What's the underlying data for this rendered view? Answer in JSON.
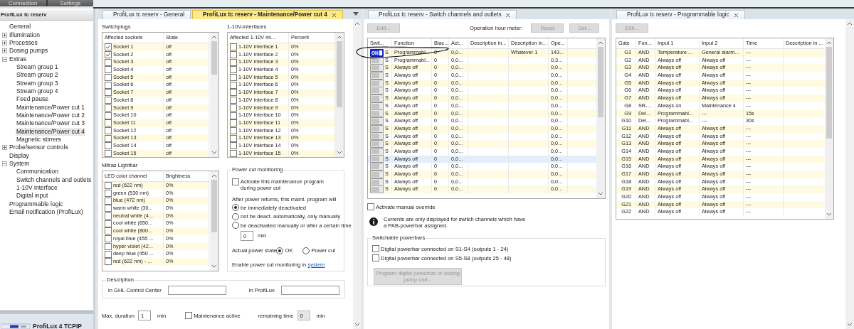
{
  "top_tabs": [
    "Connection",
    "Settings"
  ],
  "sidebar": {
    "title": "ProfiLux tc reserv",
    "tree": [
      {
        "label": "General",
        "kind": "leaf",
        "selected": false
      },
      {
        "label": "Illumination",
        "kind": "folder",
        "expanded": false,
        "selected": false
      },
      {
        "label": "Processes",
        "kind": "folder",
        "expanded": false,
        "selected": false
      },
      {
        "label": "Dosing pumps",
        "kind": "folder",
        "expanded": false,
        "selected": false
      },
      {
        "label": "Extras",
        "kind": "folder",
        "expanded": true,
        "selected": false,
        "children": [
          {
            "label": "Stream group 1",
            "selected": false
          },
          {
            "label": "Stream group 2",
            "selected": false
          },
          {
            "label": "Stream group 3",
            "selected": false
          },
          {
            "label": "Stream group 4",
            "selected": false
          },
          {
            "label": "Feed pause",
            "selected": false
          },
          {
            "label": "Maintenance/Power cut 1",
            "selected": false
          },
          {
            "label": "Maintenance/Power cut 2",
            "selected": false
          },
          {
            "label": "Maintenance/Power cut 3",
            "selected": false
          },
          {
            "label": "Maintenance/Power cut 4",
            "selected": true
          },
          {
            "label": "Magnetic stirrers",
            "selected": false
          }
        ]
      },
      {
        "label": "Probe/sensor controls",
        "kind": "folder",
        "expanded": false,
        "selected": false
      },
      {
        "label": "Display",
        "kind": "leaf",
        "selected": false
      },
      {
        "label": "System",
        "kind": "folder",
        "expanded": true,
        "selected": false,
        "children": [
          {
            "label": "Communication",
            "selected": false
          },
          {
            "label": "Switch channels and outlets",
            "selected": false
          },
          {
            "label": "1-10V interface",
            "selected": false
          },
          {
            "label": "Digital input",
            "selected": false
          }
        ]
      },
      {
        "label": "Programmable logic",
        "kind": "leaf",
        "selected": false
      },
      {
        "label": "Email notification (ProfiLux)",
        "kind": "leaf",
        "selected": false
      }
    ],
    "bottom_tab": "ProfiLux 4 TCPIP"
  },
  "maintenance_pane": {
    "tabs": [
      {
        "label": "ProfiLux tc reserv - General",
        "selected": false,
        "closable": false
      },
      {
        "label": "ProfiLux tc reserv - Maintenance/Power cut 4",
        "selected": true,
        "closable": true
      }
    ],
    "switchplugs": {
      "title": "Switchplugs",
      "kind": "list",
      "columns": [
        "Affected sockets",
        "State"
      ],
      "rows": [
        {
          "checked": true,
          "cells": [
            "Socket 1",
            "off"
          ]
        },
        {
          "checked": true,
          "cells": [
            "Socket 2",
            "off"
          ]
        },
        {
          "checked": false,
          "cells": [
            "Socket 3",
            "off"
          ]
        },
        {
          "checked": false,
          "cells": [
            "Socket 4",
            "off"
          ]
        },
        {
          "checked": false,
          "cells": [
            "Socket 5",
            "off"
          ]
        },
        {
          "checked": false,
          "cells": [
            "Socket 6",
            "off"
          ]
        },
        {
          "checked": false,
          "cells": [
            "Socket 7",
            "off"
          ]
        },
        {
          "checked": false,
          "cells": [
            "Socket 8",
            "off"
          ]
        },
        {
          "checked": false,
          "cells": [
            "Socket 9",
            "off"
          ]
        },
        {
          "checked": false,
          "cells": [
            "Socket 10",
            "off"
          ]
        },
        {
          "checked": false,
          "cells": [
            "Socket 11",
            "off"
          ]
        },
        {
          "checked": false,
          "cells": [
            "Socket 12",
            "off"
          ]
        },
        {
          "checked": false,
          "cells": [
            "Socket 13",
            "off"
          ]
        },
        {
          "checked": false,
          "cells": [
            "Socket 14",
            "off"
          ]
        },
        {
          "checked": false,
          "cells": [
            "Socket 15",
            "off"
          ]
        }
      ]
    },
    "interfaces": {
      "title": "1-10V-interfaces",
      "kind": "list",
      "columns": [
        "Affected 1-10V int...",
        "Percent"
      ],
      "rows": [
        {
          "checked": false,
          "cells": [
            "1-10V interface 1",
            "0%"
          ]
        },
        {
          "checked": false,
          "cells": [
            "1-10V interface 2",
            "0%"
          ]
        },
        {
          "checked": false,
          "cells": [
            "1-10V interface 3",
            "0%"
          ]
        },
        {
          "checked": false,
          "cells": [
            "1-10V interface 4",
            "0%"
          ]
        },
        {
          "checked": false,
          "cells": [
            "1-10V interface 5",
            "0%"
          ]
        },
        {
          "checked": false,
          "cells": [
            "1-10V interface 6",
            "0%"
          ]
        },
        {
          "checked": false,
          "cells": [
            "1-10V interface 7",
            "0%"
          ]
        },
        {
          "checked": false,
          "cells": [
            "1-10V interface 8",
            "0%"
          ]
        },
        {
          "checked": false,
          "cells": [
            "1-10V interface 9",
            "0%"
          ]
        },
        {
          "checked": false,
          "cells": [
            "1-10V interface 10",
            "0%"
          ]
        },
        {
          "checked": false,
          "cells": [
            "1-10V interface 11",
            "0%"
          ]
        },
        {
          "checked": false,
          "cells": [
            "1-10V interface 12",
            "0%"
          ]
        },
        {
          "checked": false,
          "cells": [
            "1-10V interface 13",
            "0%"
          ]
        },
        {
          "checked": false,
          "cells": [
            "1-10V interface 14",
            "0%"
          ]
        },
        {
          "checked": false,
          "cells": [
            "1-10V interface 15",
            "0%"
          ]
        }
      ]
    },
    "lightbar": {
      "title": "Mitras Lightbar",
      "kind": "list",
      "columns": [
        "LED color channel",
        "Brightness"
      ],
      "rows": [
        {
          "checked": false,
          "cells": [
            "red (622 nm)",
            "0%"
          ]
        },
        {
          "checked": false,
          "cells": [
            "green (530 nm)",
            "0%"
          ]
        },
        {
          "checked": false,
          "cells": [
            "blue (472 nm)",
            "0%"
          ]
        },
        {
          "checked": false,
          "cells": [
            "warm white (30...",
            "0%"
          ]
        },
        {
          "checked": false,
          "cells": [
            "neutral white (4...",
            "0%"
          ]
        },
        {
          "checked": false,
          "cells": [
            "cool white (650...",
            "0%"
          ]
        },
        {
          "checked": false,
          "cells": [
            "cool white (800...",
            "0%"
          ]
        },
        {
          "checked": false,
          "cells": [
            "royal blue (455 ...",
            "0%"
          ]
        },
        {
          "checked": false,
          "cells": [
            "hyper violet (42...",
            "0%"
          ]
        },
        {
          "checked": false,
          "cells": [
            "deep blue (450 ...",
            "0%"
          ]
        },
        {
          "checked": false,
          "cells": [
            "red (622 nm) - ...",
            "0%"
          ]
        }
      ]
    },
    "power_cut": {
      "title": "Power cut monitoring",
      "activate": {
        "label": "Activate this maintenance program during power cut",
        "checked": false
      },
      "after_label": "After power returns, this maint. program will",
      "options": [
        {
          "label": "be immediately deactivated",
          "selected": true
        },
        {
          "label": "not be deact. automatically, only manually",
          "selected": false
        },
        {
          "label": "be deactivated manually or after a certain time",
          "selected": false
        }
      ],
      "time_value": "0",
      "time_unit": "min",
      "state_label": "Actual power state",
      "states": [
        {
          "label": "OK",
          "selected": true
        },
        {
          "label": "Power cut",
          "selected": false
        }
      ],
      "enable_text": "Enable power cut monitoring in",
      "enable_link": "system"
    },
    "description": {
      "title": "Description",
      "fields": [
        {
          "label": "in GHL Control Center"
        },
        {
          "label": "in ProfiLux"
        }
      ]
    },
    "max_duration": {
      "label": "Max. duration",
      "value": "1",
      "unit": "min"
    },
    "maintenance_active": {
      "label": "Maintenance active",
      "checked": false
    },
    "remaining": {
      "label": "remaining time",
      "value": "0",
      "unit": "min"
    }
  },
  "switch_pane": {
    "tabs": [
      {
        "label": "ProfiLux tc reserv - Switch channels and outlets",
        "selected": false,
        "closable": true
      }
    ],
    "edit_button": "Edit...",
    "meter_label": "Operation hour meter:",
    "reset_button": "Reset",
    "set_button": "Set...",
    "table": {
      "kind": "switch",
      "columns": [
        "Swit...",
        "Function",
        "Blac...",
        "Act...",
        "Description in...",
        "Description in...",
        "Ope..."
      ],
      "rows": [
        {
          "switch": {
            "on": true,
            "label": "ON"
          },
          "selected": false,
          "cells": [
            "S",
            "Programmabl...",
            "0",
            "0,0...",
            null,
            "Whatever 1",
            "143..."
          ]
        },
        {
          "switch": {
            "on": false
          },
          "selected": false,
          "cells": [
            "S",
            "Programmabl...",
            "0",
            "0,0...",
            null,
            null,
            "0,3..."
          ]
        },
        {
          "switch": {
            "on": false
          },
          "selected": false,
          "cells": [
            "S",
            "Always off",
            "0",
            "0,0...",
            null,
            null,
            "0,0..."
          ]
        },
        {
          "switch": {
            "on": false
          },
          "selected": false,
          "cells": [
            "S",
            "Always off",
            "0",
            "0,0...",
            null,
            null,
            "0,0..."
          ]
        },
        {
          "switch": {
            "on": false
          },
          "selected": false,
          "cells": [
            "S",
            "Always off",
            "0",
            "0,0...",
            null,
            null,
            "0,0..."
          ]
        },
        {
          "switch": {
            "on": false
          },
          "selected": false,
          "cells": [
            "S",
            "Always off",
            "0",
            "0,0...",
            null,
            null,
            "0,0..."
          ]
        },
        {
          "switch": {
            "on": false
          },
          "selected": false,
          "cells": [
            "S",
            "Always off",
            "0",
            "0,0...",
            null,
            null,
            "0,0..."
          ]
        },
        {
          "switch": {
            "on": false
          },
          "selected": false,
          "cells": [
            "S",
            "Always off",
            "0",
            "0,0...",
            null,
            null,
            "0,0..."
          ]
        },
        {
          "switch": {
            "on": false
          },
          "selected": false,
          "cells": [
            "S",
            "Always off",
            "0",
            "0,0...",
            null,
            null,
            "0,0..."
          ]
        },
        {
          "switch": {
            "on": false
          },
          "selected": false,
          "cells": [
            "S",
            "Always off",
            "0",
            "0,0...",
            null,
            null,
            "0,0..."
          ]
        },
        {
          "switch": {
            "on": false
          },
          "selected": false,
          "cells": [
            "S",
            "Always off",
            "0",
            "0,0...",
            null,
            null,
            "0,0..."
          ]
        },
        {
          "switch": {
            "on": false
          },
          "selected": false,
          "cells": [
            "S",
            "Always off",
            "0",
            "0,0...",
            null,
            null,
            "0,0..."
          ]
        },
        {
          "switch": {
            "on": false
          },
          "selected": false,
          "cells": [
            "S",
            "Always off",
            "0",
            "0,0...",
            null,
            null,
            "0,0..."
          ]
        },
        {
          "switch": {
            "on": false
          },
          "selected": false,
          "cells": [
            "S",
            "Always off",
            "0",
            "0,0...",
            null,
            null,
            "0,0..."
          ]
        },
        {
          "switch": {
            "on": false
          },
          "selected": true,
          "cells": [
            "S",
            "Always off",
            "0",
            "0,0...",
            null,
            null,
            "0,0..."
          ]
        },
        {
          "switch": {
            "on": false
          },
          "selected": false,
          "cells": [
            "S",
            "Always off",
            "0",
            "0,0...",
            null,
            null,
            "0,0..."
          ]
        },
        {
          "switch": {
            "on": false
          },
          "selected": false,
          "cells": [
            "S",
            "Always off",
            "0",
            "0,0...",
            null,
            null,
            "0,0..."
          ]
        },
        {
          "switch": {
            "on": false
          },
          "selected": false,
          "cells": [
            "S",
            "Always off",
            "0",
            "0,0...",
            null,
            null,
            "0,0..."
          ]
        },
        {
          "switch": {
            "on": false
          },
          "selected": false,
          "cells": [
            "S",
            "Always off",
            "0",
            "0,0...",
            null,
            null,
            "0,0..."
          ]
        }
      ]
    },
    "manual_override": {
      "label": "Activate manual override",
      "checked": false
    },
    "info": "Currents are only displayed for switch channels which have a PAB-powerbar assigned.",
    "powerbars": {
      "title": "Switchable powerbars",
      "options": [
        {
          "label": "Digital powerbar connected on  S1-S4 (outputs 1 - 24)",
          "checked": false
        },
        {
          "label": "Digital powerbar connected on  S5-S8 (outputs 25 - 48)",
          "checked": false
        }
      ],
      "program_button": "Program digital powerbar or dosing pump unit..."
    }
  },
  "logic_pane": {
    "tabs": [
      {
        "label": "ProfiLux tc reserv - Programmable logic",
        "selected": false,
        "closable": true
      }
    ],
    "edit_button": "Edit...",
    "table": {
      "kind": "logic",
      "columns": [
        "Gate",
        "Fun...",
        "Input 1",
        "Input 2",
        "Time",
        "Description in ..."
      ],
      "rows": [
        {
          "cells": [
            "G1",
            "AND",
            "Temperature ...",
            "General alarm...",
            "---",
            null
          ]
        },
        {
          "cells": [
            "G2",
            "AND",
            "Always off",
            "Always off",
            "---",
            null
          ]
        },
        {
          "cells": [
            "G3",
            "AND",
            "Always off",
            "Always off",
            "---",
            null
          ]
        },
        {
          "cells": [
            "G4",
            "AND",
            "Always off",
            "Always off",
            "---",
            null
          ]
        },
        {
          "cells": [
            "G5",
            "AND",
            "Always off",
            "Always off",
            "---",
            null
          ]
        },
        {
          "cells": [
            "G6",
            "AND",
            "Always off",
            "Always off",
            "---",
            null
          ]
        },
        {
          "cells": [
            "G7",
            "AND",
            "Always off",
            "Always off",
            "---",
            null
          ]
        },
        {
          "cells": [
            "G8",
            "SR-...",
            "Always on",
            "Maintenance 4",
            "---",
            null
          ]
        },
        {
          "cells": [
            "G9",
            "Del...",
            "Programmabl...",
            "---",
            "15s",
            null
          ]
        },
        {
          "cells": [
            "G10",
            "Del...",
            "Programmabl...",
            "---",
            "30s",
            null
          ]
        },
        {
          "cells": [
            "G11",
            "AND",
            "Always off",
            "Always off",
            "---",
            null
          ]
        },
        {
          "cells": [
            "G12",
            "AND",
            "Always off",
            "Always off",
            "---",
            null
          ]
        },
        {
          "cells": [
            "G13",
            "AND",
            "Always off",
            "Always off",
            "---",
            null
          ]
        },
        {
          "cells": [
            "G14",
            "AND",
            "Always off",
            "Always off",
            "---",
            null
          ]
        },
        {
          "cells": [
            "G15",
            "AND",
            "Always off",
            "Always off",
            "---",
            null
          ]
        },
        {
          "cells": [
            "G16",
            "AND",
            "Always off",
            "Always off",
            "---",
            null
          ]
        },
        {
          "cells": [
            "G17",
            "AND",
            "Always off",
            "Always off",
            "---",
            null
          ]
        },
        {
          "cells": [
            "G18",
            "AND",
            "Always off",
            "Always off",
            "---",
            null
          ]
        },
        {
          "cells": [
            "G19",
            "AND",
            "Always off",
            "Always off",
            "---",
            null
          ]
        },
        {
          "cells": [
            "G20",
            "AND",
            "Always off",
            "Always off",
            "---",
            null
          ]
        },
        {
          "cells": [
            "G21",
            "AND",
            "Always off",
            "Always off",
            "---",
            null
          ]
        },
        {
          "cells": [
            "G22",
            "AND",
            "Always off",
            "Always off",
            "---",
            null
          ]
        }
      ]
    }
  }
}
